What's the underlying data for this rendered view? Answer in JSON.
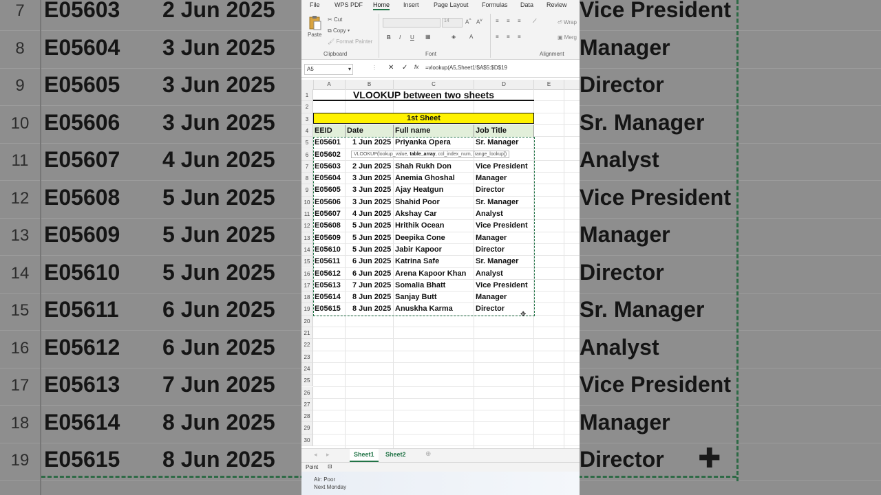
{
  "background": {
    "rows": [
      {
        "num": "7",
        "id": "E05603",
        "date": "2 Jun 2025",
        "title": "Vice President"
      },
      {
        "num": "8",
        "id": "E05604",
        "date": "3 Jun 2025",
        "title": "Manager"
      },
      {
        "num": "9",
        "id": "E05605",
        "date": "3 Jun 2025",
        "title": "Director"
      },
      {
        "num": "10",
        "id": "E05606",
        "date": "3 Jun 2025",
        "title": "Sr. Manager"
      },
      {
        "num": "11",
        "id": "E05607",
        "date": "4 Jun 2025",
        "title": "Analyst"
      },
      {
        "num": "12",
        "id": "E05608",
        "date": "5 Jun 2025",
        "title": "Vice President"
      },
      {
        "num": "13",
        "id": "E05609",
        "date": "5 Jun 2025",
        "title": "Manager"
      },
      {
        "num": "14",
        "id": "E05610",
        "date": "5 Jun 2025",
        "title": "Director"
      },
      {
        "num": "15",
        "id": "E05611",
        "date": "6 Jun 2025",
        "title": "Sr. Manager"
      },
      {
        "num": "16",
        "id": "E05612",
        "date": "6 Jun 2025",
        "title": "Analyst"
      },
      {
        "num": "17",
        "id": "E05613",
        "date": "7 Jun 2025",
        "title": "Vice President"
      },
      {
        "num": "18",
        "id": "E05614",
        "date": "8 Jun 2025",
        "title": "Manager"
      },
      {
        "num": "19",
        "id": "E05615",
        "date": "8 Jun 2025",
        "title": "Director"
      }
    ]
  },
  "menu": [
    "File",
    "WPS PDF",
    "Home",
    "Insert",
    "Page Layout",
    "Formulas",
    "Data",
    "Review"
  ],
  "ribbon": {
    "paste": "Paste",
    "cut": "Cut",
    "copy": "Copy",
    "format_painter": "Format Painter",
    "clipboard_label": "Clipboard",
    "font_label": "Font",
    "font_size": "14",
    "alignment_label": "Alignment",
    "wrap": "Wrap",
    "merge": "Merg"
  },
  "formula_bar": {
    "name_box": "A5",
    "fx": "fx",
    "formula": "=vlookup(A5,Sheet1!$A$5:$D$19"
  },
  "columns": [
    "A",
    "B",
    "C",
    "D",
    "E"
  ],
  "row_numbers": [
    "1",
    "2",
    "3",
    "4",
    "5",
    "6",
    "7",
    "8",
    "9",
    "10",
    "11",
    "12",
    "13",
    "14",
    "15",
    "16",
    "17",
    "18",
    "19",
    "20",
    "21",
    "22",
    "23",
    "24",
    "25",
    "26",
    "27",
    "28",
    "29",
    "30"
  ],
  "sheet": {
    "title": "VLOOKUP between two sheets",
    "banner": "1st Sheet",
    "headers": [
      "EEID",
      "Date",
      "Full name",
      "Job Title"
    ],
    "rows": [
      [
        "E05601",
        "1 Jun 2025",
        "Priyanka Opera",
        "Sr. Manager"
      ],
      [
        "E05602",
        "",
        "",
        ""
      ],
      [
        "E05603",
        "2 Jun 2025",
        "Shah Rukh Don",
        "Vice President"
      ],
      [
        "E05604",
        "3 Jun 2025",
        "Anemia Ghoshal",
        "Manager"
      ],
      [
        "E05605",
        "3 Jun 2025",
        "Ajay Heatgun",
        "Director"
      ],
      [
        "E05606",
        "3 Jun 2025",
        "Shahid Poor",
        "Sr. Manager"
      ],
      [
        "E05607",
        "4 Jun 2025",
        "Akshay Car",
        "Analyst"
      ],
      [
        "E05608",
        "5 Jun 2025",
        "Hrithik Ocean",
        "Vice President"
      ],
      [
        "E05609",
        "5 Jun 2025",
        "Deepika Cone",
        "Manager"
      ],
      [
        "E05610",
        "5 Jun 2025",
        "Jabir Kapoor",
        "Director"
      ],
      [
        "E05611",
        "6 Jun 2025",
        "Katrina Safe",
        "Sr. Manager"
      ],
      [
        "E05612",
        "6 Jun 2025",
        "Arena Kapoor Khan",
        "Analyst"
      ],
      [
        "E05613",
        "7 Jun 2025",
        "Somalia Bhatt",
        "Vice President"
      ],
      [
        "E05614",
        "8 Jun 2025",
        "Sanjay Butt",
        "Manager"
      ],
      [
        "E05615",
        "8 Jun 2025",
        "Anuskha Karma",
        "Director"
      ]
    ]
  },
  "tooltip": {
    "prefix": "VLOOKUP(lookup_value, ",
    "bold": "table_array",
    "suffix": ", col_index_num, [range_lookup])"
  },
  "tabs": [
    "Sheet1",
    "Sheet2"
  ],
  "status": {
    "mode": "Point"
  },
  "taskbar": {
    "line1": "Air: Poor",
    "line2": "Next Monday"
  },
  "colors": {
    "accent": "#217346",
    "banner": "#fff200",
    "header_fill": "#e2efda"
  }
}
